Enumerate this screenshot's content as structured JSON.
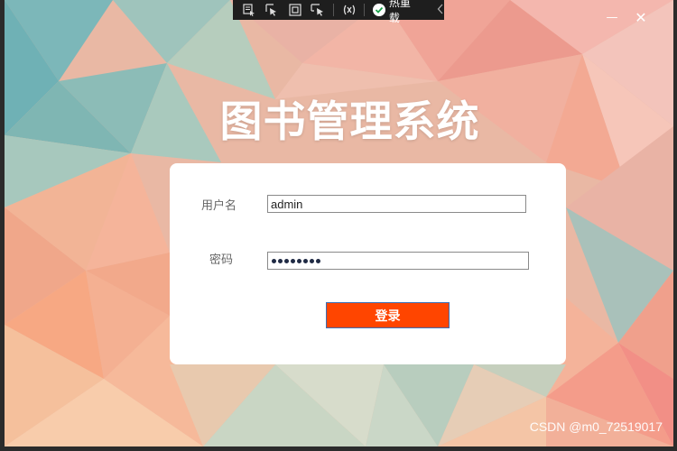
{
  "app": {
    "title": "图书管理系统"
  },
  "toolbar": {
    "hot_reload_label": "热重载",
    "icons": [
      "select-element-icon",
      "pointer-icon",
      "layout-adorner-icon",
      "track-focus-icon",
      "binding-failures-icon",
      "hot-reload-check-icon",
      "collapse-chevron-icon"
    ]
  },
  "window_controls": {
    "minimize": "—",
    "close": "✕"
  },
  "form": {
    "username_label": "用户名",
    "username_value": "admin",
    "password_label": "密码",
    "password_mask_count": 8,
    "login_label": "登录"
  },
  "watermark": "CSDN @m0_72519017",
  "colors": {
    "login_button": "#ff4500",
    "login_border": "#3b6fb6",
    "card": "#ffffff",
    "toolbar": "#1e1e1e"
  }
}
